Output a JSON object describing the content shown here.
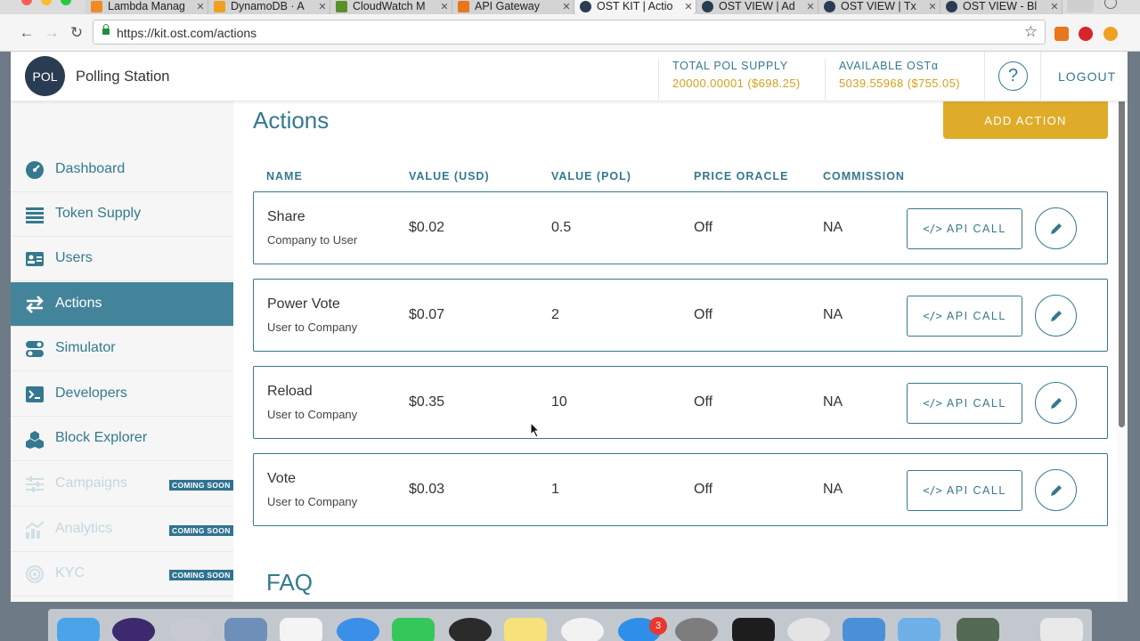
{
  "browser": {
    "tabs": [
      {
        "label": "Lambda Manag",
        "color": "#f08a24"
      },
      {
        "label": "DynamoDB · A",
        "color": "#f0a020"
      },
      {
        "label": "CloudWatch M",
        "color": "#5a8f29"
      },
      {
        "label": "API Gateway",
        "color": "#e8761d"
      },
      {
        "label": "OST KIT | Actio",
        "color": "#2a3c52",
        "active": true
      },
      {
        "label": "OST VIEW | Ad",
        "color": "#2a3c52"
      },
      {
        "label": "OST VIEW | Tx",
        "color": "#2a3c52"
      },
      {
        "label": "OST VIEW - Bl",
        "color": "#2a3c52"
      }
    ],
    "url": "https://kit.ost.com/actions",
    "back_icon": "arrow-left-icon",
    "forward_icon": "arrow-right-icon",
    "reload_icon": "reload-icon",
    "bookmark_icon": "star-icon"
  },
  "header": {
    "avatar": "POL",
    "brand": "Polling Station",
    "total_supply_label": "TOTAL POL SUPPLY",
    "total_supply_value": "20000.00001 ($698.25)",
    "available_label": "AVAILABLE OSTα",
    "available_value": "5039.55968 ($755.05)",
    "help_icon": "?",
    "logout": "LOGOUT"
  },
  "sidebar": {
    "items": [
      {
        "label": "Dashboard",
        "icon": "gauge-icon"
      },
      {
        "label": "Token Supply",
        "icon": "list-icon"
      },
      {
        "label": "Users",
        "icon": "id-card-icon"
      },
      {
        "label": "Actions",
        "icon": "exchange-arrows-icon",
        "active": true
      },
      {
        "label": "Simulator",
        "icon": "toggle-icon"
      },
      {
        "label": "Developers",
        "icon": "terminal-icon"
      },
      {
        "label": "Block Explorer",
        "icon": "cubes-icon"
      },
      {
        "label": "Campaigns",
        "icon": "sliders-icon",
        "disabled": true,
        "badge": "COMING SOON"
      },
      {
        "label": "Analytics",
        "icon": "chart-icon",
        "disabled": true,
        "badge": "COMING SOON"
      },
      {
        "label": "KYC",
        "icon": "fingerprint-icon",
        "disabled": true,
        "badge": "COMING SOON"
      }
    ]
  },
  "main": {
    "title": "Actions",
    "add_button": "ADD ACTION",
    "columns": [
      "NAME",
      "VALUE (USD)",
      "VALUE (POL)",
      "PRICE ORACLE",
      "COMMISSION"
    ],
    "rows": [
      {
        "name": "Share",
        "direction": "Company to User",
        "usd": "$0.02",
        "pol": "0.5",
        "oracle": "Off",
        "commission": "NA"
      },
      {
        "name": "Power Vote",
        "direction": "User to Company",
        "usd": "$0.07",
        "pol": "2",
        "oracle": "Off",
        "commission": "NA"
      },
      {
        "name": "Reload",
        "direction": "User to Company",
        "usd": "$0.35",
        "pol": "10",
        "oracle": "Off",
        "commission": "NA"
      },
      {
        "name": "Vote",
        "direction": "User to Company",
        "usd": "$0.03",
        "pol": "1",
        "oracle": "Off",
        "commission": "NA"
      }
    ],
    "api_button": "API CALL",
    "api_code_glyph": "</>",
    "faq_title": "FAQ"
  },
  "dock": {
    "appstore_badge": "3"
  },
  "colors": {
    "teal": "#34798f",
    "gold": "#dfac2a",
    "active_nav": "#44849b",
    "navy": "#2a3c52"
  }
}
